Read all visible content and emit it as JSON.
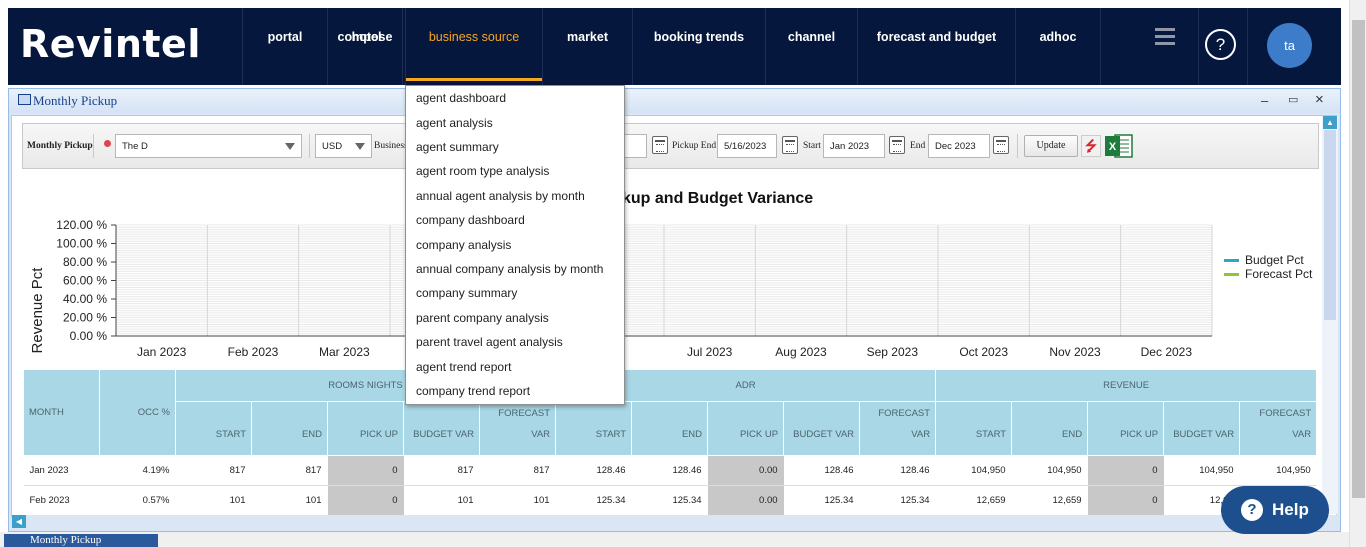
{
  "app": {
    "logo": "Revintel"
  },
  "nav": {
    "items": [
      {
        "label": "portal"
      },
      {
        "label": "compose"
      },
      {
        "label": "hotel"
      },
      {
        "label": "business source",
        "active": true
      },
      {
        "label": "market"
      },
      {
        "label": "booking trends"
      },
      {
        "label": "channel"
      },
      {
        "label": "forecast and budget"
      },
      {
        "label": "adhoc"
      }
    ],
    "help_icon": "?",
    "avatar_initials": "ta"
  },
  "window": {
    "title": "Monthly Pickup",
    "controls": {
      "minimize": "–",
      "maximize": "▭",
      "close": "×"
    }
  },
  "toolbar": {
    "report_label": "Monthly Pickup",
    "property_value": "The D",
    "currency_value": "USD",
    "business_label": "Business",
    "pickup_start_value_partial": "23",
    "pickup_end_label": "Pickup End",
    "pickup_end_value": "5/16/2023",
    "start_label": "Start",
    "start_value": "Jan 2023",
    "end_label": "End",
    "end_value": "Dec 2023",
    "update_label": "Update",
    "excel_letter": "X"
  },
  "dropdown": {
    "items": [
      "agent dashboard",
      "agent analysis",
      "agent summary",
      "agent room type analysis",
      "annual agent analysis by month",
      "company dashboard",
      "company analysis",
      "annual company analysis by month",
      "company summary",
      "parent company analysis",
      "parent travel agent analysis",
      "agent trend report",
      "company trend report"
    ]
  },
  "chart_data": {
    "type": "line",
    "title_visible": "kup and Budget Variance",
    "ylabel": "Revenue Pct",
    "y_ticks": [
      "120.00 %",
      "100.00 %",
      "80.00 %",
      "60.00 %",
      "40.00 %",
      "20.00 %",
      "0.00 %"
    ],
    "ylim": [
      0,
      120
    ],
    "categories": [
      "Jan 2023",
      "Feb 2023",
      "Mar 2023",
      "Apr 2023",
      "May 2023",
      "Jun 2023",
      "Jul 2023",
      "Aug 2023",
      "Sep 2023",
      "Oct 2023",
      "Nov 2023",
      "Dec 2023"
    ],
    "x_tick_labels_visible": [
      "Jan 2023",
      "Feb 2023",
      "Mar 2023",
      "",
      "",
      "23",
      "Jul 2023",
      "Aug 2023",
      "Sep 2023",
      "Oct 2023",
      "Nov 2023",
      "Dec 2023"
    ],
    "series": [
      {
        "name": "Budget Pct",
        "color": "#2aa8c9",
        "values": []
      },
      {
        "name": "Forecast Pct",
        "color": "#8cc63f",
        "values": []
      }
    ],
    "grid": true,
    "legend_position": "right"
  },
  "table": {
    "groups": [
      {
        "label": "ROOMS NIGHTS"
      },
      {
        "label": "ADR"
      },
      {
        "label": "REVENUE"
      }
    ],
    "month_header": "MONTH",
    "occ_header": "OCC %",
    "sub_headers": {
      "start": "START",
      "end": "END",
      "pickup": "PICK UP",
      "budget_var": "BUDGET VAR",
      "forecast_var_1": "FORECAST",
      "forecast_var_2": "VAR"
    },
    "rows": [
      {
        "month": "Jan 2023",
        "occ": "4.19%",
        "rn": [
          "817",
          "817",
          "0",
          "817",
          "817"
        ],
        "adr": [
          "128.46",
          "128.46",
          "0.00",
          "128.46",
          "128.46"
        ],
        "rev": [
          "104,950",
          "104,950",
          "0",
          "104,950",
          "104,950"
        ]
      },
      {
        "month": "Feb 2023",
        "occ": "0.57%",
        "rn": [
          "101",
          "101",
          "0",
          "101",
          "101"
        ],
        "adr": [
          "125.34",
          "125.34",
          "0.00",
          "125.34",
          "125.34"
        ],
        "rev": [
          "12,659",
          "12,659",
          "0",
          "12,65",
          ""
        ]
      }
    ]
  },
  "taskbar": {
    "tab_label": "Monthly Pickup"
  },
  "help_button": {
    "icon": "?",
    "label": "Help"
  }
}
